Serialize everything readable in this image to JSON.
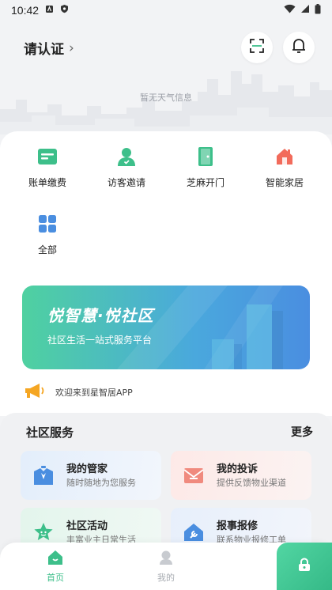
{
  "status_bar": {
    "time": "10:42"
  },
  "header": {
    "certify_label": "请认证",
    "weather_text": "暂无天气信息"
  },
  "quick_actions": [
    {
      "label": "账单缴费",
      "icon": "bill-icon",
      "color": "#3dbf8a"
    },
    {
      "label": "访客邀请",
      "icon": "visitor-icon",
      "color": "#3dbf8a"
    },
    {
      "label": "芝麻开门",
      "icon": "door-icon",
      "color": "#3dbf8a"
    },
    {
      "label": "智能家居",
      "icon": "smart-home-icon",
      "color": "#f26b5b"
    },
    {
      "label": "全部",
      "icon": "grid-icon",
      "color": "#4a8ee0"
    }
  ],
  "banner": {
    "title": "悦智慧·悦社区",
    "subtitle": "社区生活一站式服务平台"
  },
  "notice": {
    "text": "欢迎来到星智居APP"
  },
  "services": {
    "title": "社区服务",
    "more_label": "更多",
    "cards": [
      {
        "title": "我的管家",
        "subtitle": "随时随地为您服务",
        "icon": "butler-icon"
      },
      {
        "title": "我的投诉",
        "subtitle": "提供反馈物业渠道",
        "icon": "complaint-icon"
      },
      {
        "title": "社区活动",
        "subtitle": "丰富业主日常生活",
        "icon": "activity-icon"
      },
      {
        "title": "报事报修",
        "subtitle": "联系物业报修工单",
        "icon": "repair-icon"
      }
    ]
  },
  "tabbar": {
    "tabs": [
      {
        "label": "首页",
        "icon": "home-icon",
        "active": true
      },
      {
        "label": "我的",
        "icon": "profile-icon",
        "active": false
      }
    ],
    "fab_icon": "lock-icon"
  },
  "colors": {
    "accent": "#3dbf8a",
    "banner_start": "#4fd1a0",
    "banner_end": "#4a8ee0"
  }
}
